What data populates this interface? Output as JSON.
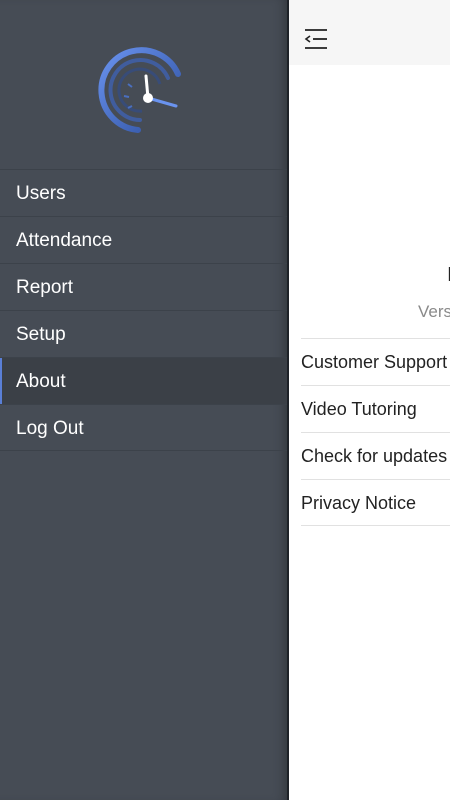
{
  "sidebar": {
    "logo_icon": "speedometer-icon",
    "items": [
      {
        "label": "Users"
      },
      {
        "label": "Attendance"
      },
      {
        "label": "Report"
      },
      {
        "label": "Setup"
      },
      {
        "label": "About",
        "active": true
      },
      {
        "label": "Log Out"
      }
    ]
  },
  "main": {
    "menu_icon": "hamburger-collapse-icon",
    "app_title": "I",
    "version": "Vers",
    "links": [
      {
        "label": "Customer Support"
      },
      {
        "label": "Video Tutoring"
      },
      {
        "label": "Check for updates"
      },
      {
        "label": "Privacy Notice"
      }
    ]
  },
  "colors": {
    "sidebar_bg": "#464c55",
    "active_bg": "#3b4047",
    "accent": "#5a7fd6"
  }
}
